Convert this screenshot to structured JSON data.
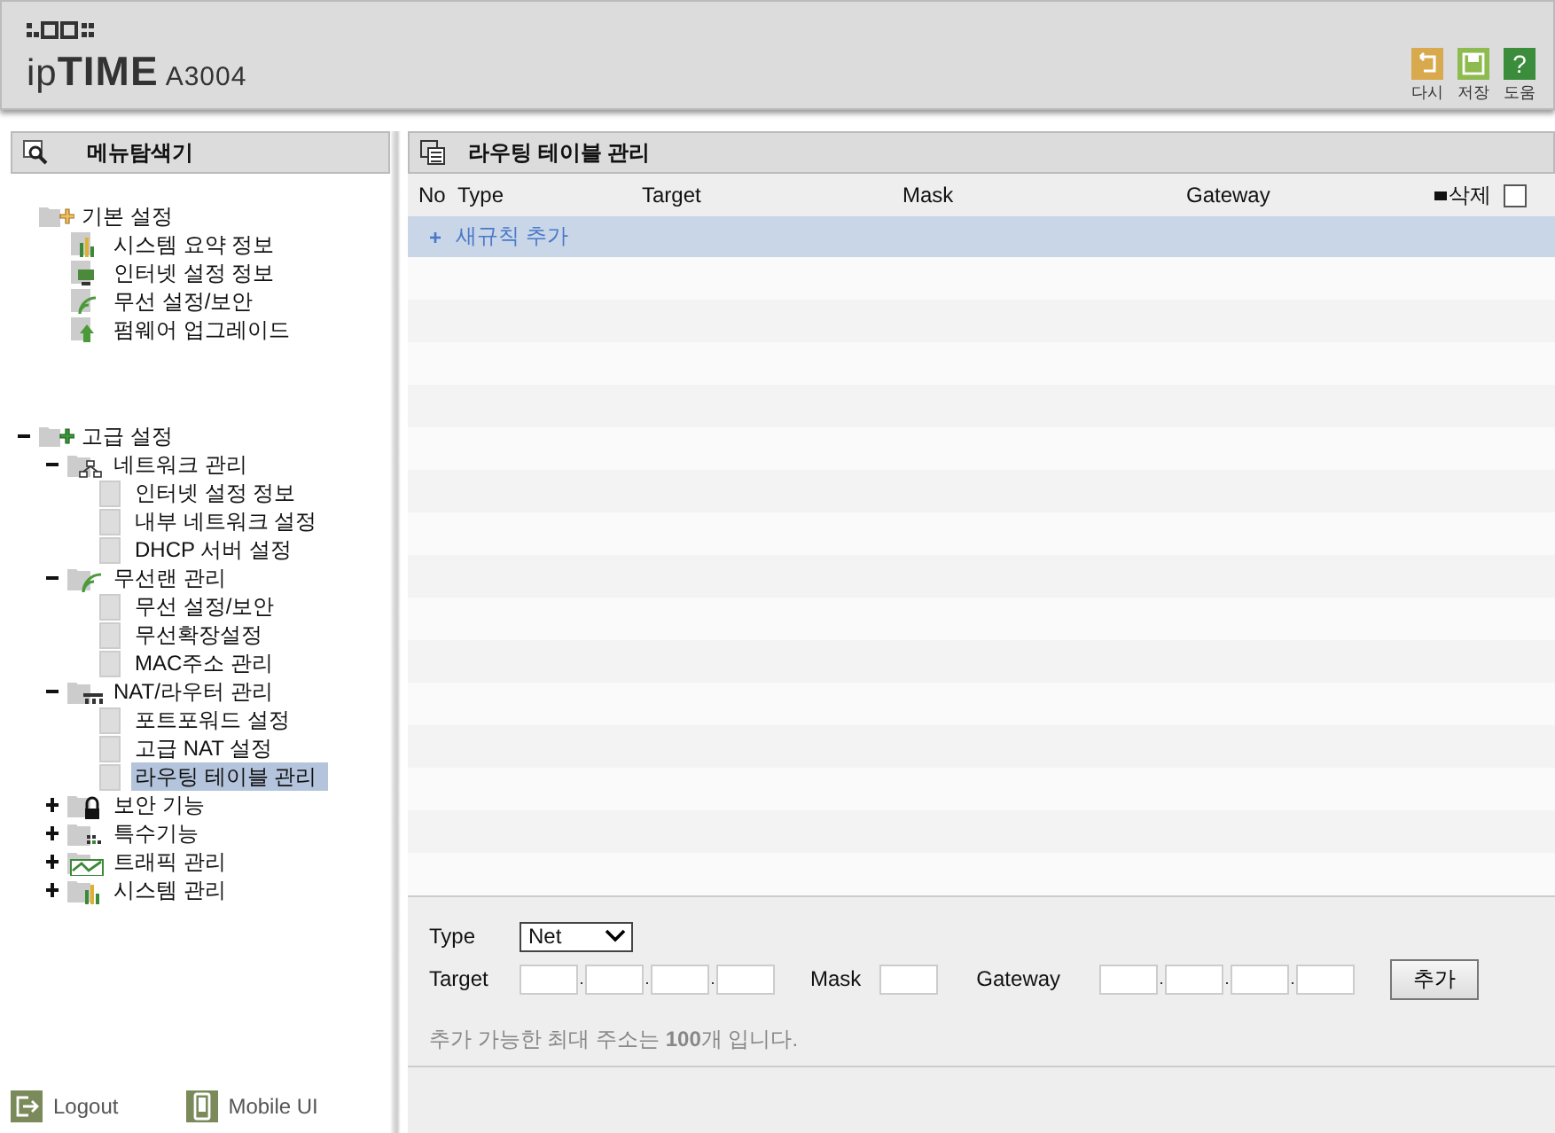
{
  "header": {
    "logo": "ip**TIME**",
    "model": "A3004",
    "actions": [
      {
        "label": "다시",
        "kind": "redo"
      },
      {
        "label": "저장",
        "kind": "save"
      },
      {
        "label": "도움",
        "kind": "help",
        "icon_text": "?"
      }
    ]
  },
  "sidebar": {
    "title": "메뉴탐색기",
    "basic": {
      "label": "기본 설정",
      "items": [
        {
          "label": "시스템 요약 정보",
          "kind": "chart"
        },
        {
          "label": "인터넷 설정 정보",
          "kind": "monitor"
        },
        {
          "label": "무선 설정/보안",
          "kind": "wifi"
        },
        {
          "label": "펌웨어 업그레이드",
          "kind": "upload"
        }
      ]
    },
    "advanced": {
      "label": "고급 설정",
      "expanded": true,
      "groups": [
        {
          "label": "네트워크 관리",
          "kind": "network",
          "expanded": true,
          "children": [
            {
              "label": "인터넷 설정 정보",
              "selected": false
            },
            {
              "label": "내부 네트워크 설정",
              "selected": false
            },
            {
              "label": "DHCP 서버 설정",
              "selected": false
            }
          ]
        },
        {
          "label": "무선랜 관리",
          "kind": "wifi",
          "expanded": true,
          "children": [
            {
              "label": "무선 설정/보안",
              "selected": false
            },
            {
              "label": "무선확장설정",
              "selected": false
            },
            {
              "label": "MAC주소 관리",
              "selected": false
            }
          ]
        },
        {
          "label": "NAT/라우터 관리",
          "kind": "router",
          "expanded": true,
          "children": [
            {
              "label": "포트포워드 설정",
              "selected": false
            },
            {
              "label": "고급 NAT 설정",
              "selected": false
            },
            {
              "label": "라우팅 테이블 관리",
              "selected": true
            }
          ]
        },
        {
          "label": "보안 기능",
          "kind": "lock",
          "expanded": false
        },
        {
          "label": "특수기능",
          "kind": "grid",
          "expanded": false
        },
        {
          "label": "트래픽 관리",
          "kind": "traffic",
          "expanded": false
        },
        {
          "label": "시스템 관리",
          "kind": "chart",
          "expanded": false
        }
      ]
    },
    "footer": [
      {
        "label": "Logout",
        "kind": "logout"
      },
      {
        "label": "Mobile UI",
        "kind": "mobile"
      }
    ]
  },
  "main": {
    "title": "라우팅 테이블 관리",
    "table": {
      "columns": [
        "No",
        "Type",
        "Target",
        "Mask",
        "Gateway"
      ],
      "delete_label": "삭제",
      "delete_all_checked": false,
      "add_row": {
        "icon_text": "+",
        "label": "새규칙 추가"
      }
    },
    "form": {
      "type_label": "Type",
      "type_value": "Net",
      "target_label": "Target",
      "target_separators": [
        ".",
        ".",
        "."
      ],
      "gateway_separators": [
        ".",
        ".",
        "."
      ],
      "mask_label": "Mask",
      "gateway_label": "Gateway",
      "add_button": "추가",
      "note": "추가 가능한 최대 주소는 **100**개 입니다."
    }
  }
}
